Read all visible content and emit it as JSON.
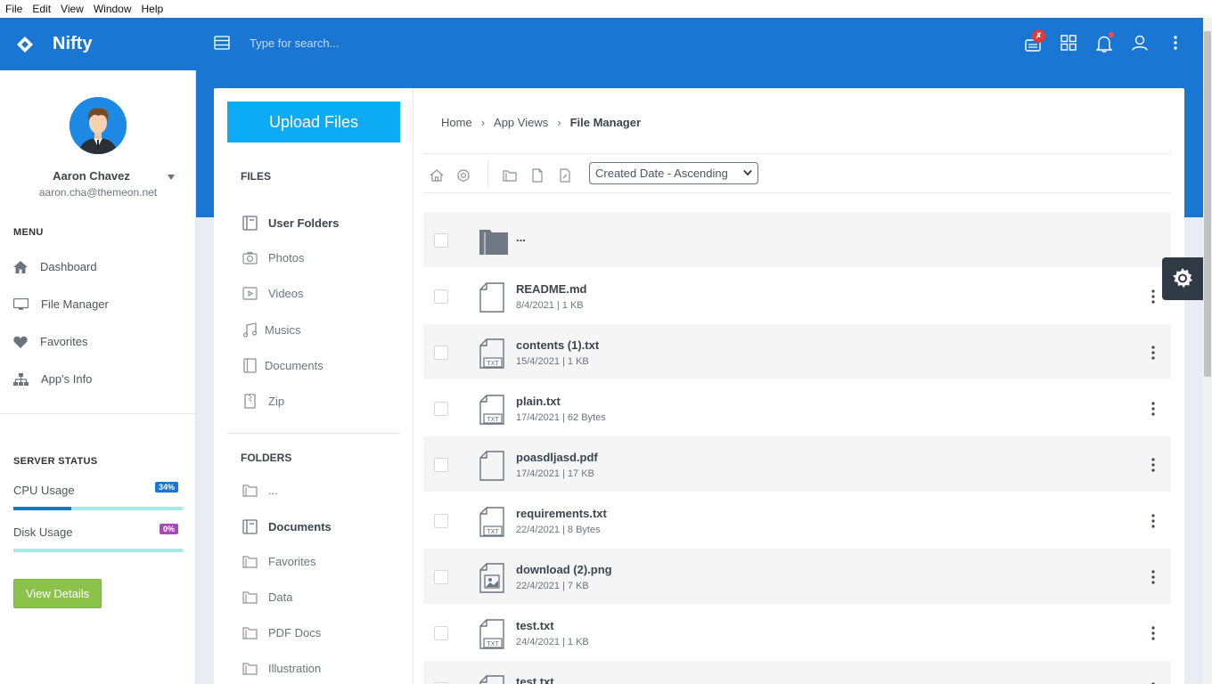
{
  "menubar": [
    "File",
    "Edit",
    "View",
    "Window",
    "Help"
  ],
  "brand": {
    "name": "Nifty"
  },
  "search": {
    "placeholder": "Type for search..."
  },
  "profile": {
    "name": "Aaron Chavez",
    "email": "aaron.cha@themeon.net"
  },
  "menu": {
    "title": "MENU",
    "items": [
      {
        "label": "Dashboard",
        "icon": "home-icon"
      },
      {
        "label": "File Manager",
        "icon": "monitor-icon"
      },
      {
        "label": "Favorites",
        "icon": "heart-icon"
      },
      {
        "label": "App's Info",
        "icon": "sitemap-icon"
      }
    ]
  },
  "server_status": {
    "title": "SERVER STATUS",
    "cpu": {
      "label": "CPU Usage",
      "badge": "34%",
      "value": 34,
      "color": "#1976d2"
    },
    "disk": {
      "label": "Disk Usage",
      "badge": "0%",
      "value": 0,
      "color": "#ab47bc"
    },
    "button": "View Details"
  },
  "files_pane": {
    "upload": "Upload Files",
    "files_title": "FILES",
    "files": [
      "User Folders",
      "Photos",
      "Videos",
      "Musics",
      "Documents",
      "Zip"
    ],
    "folders_title": "FOLDERS",
    "folders": [
      "...",
      "Documents",
      "Favorites",
      "Data",
      "PDF Docs",
      "Illustration"
    ]
  },
  "breadcrumb": {
    "home": "Home",
    "section": "App Views",
    "current": "File Manager"
  },
  "sort": {
    "selected": "Created Date - Ascending"
  },
  "parent": "...",
  "files": [
    {
      "name": "README.md",
      "date": "8/4/2021",
      "size": "1 KB",
      "icon": "file-icon"
    },
    {
      "name": "contents (1).txt",
      "date": "15/4/2021",
      "size": "1 KB",
      "icon": "txt-file-icon"
    },
    {
      "name": "plain.txt",
      "date": "17/4/2021",
      "size": "62 Bytes",
      "icon": "txt-file-icon"
    },
    {
      "name": "poasdljasd.pdf",
      "date": "17/4/2021",
      "size": "17 KB",
      "icon": "file-icon"
    },
    {
      "name": "requirements.txt",
      "date": "22/4/2021",
      "size": "8 Bytes",
      "icon": "txt-file-icon"
    },
    {
      "name": "download (2).png",
      "date": "22/4/2021",
      "size": "7 KB",
      "icon": "image-file-icon"
    },
    {
      "name": "test.txt",
      "date": "24/4/2021",
      "size": "1 KB",
      "icon": "txt-file-icon"
    },
    {
      "name": "test.txt",
      "date": "",
      "size": "",
      "icon": "txt-file-icon"
    }
  ],
  "colors": {
    "primary": "#1976d2",
    "upload": "#0dabf4",
    "success": "#8bc34a",
    "notification": "#e53935"
  }
}
